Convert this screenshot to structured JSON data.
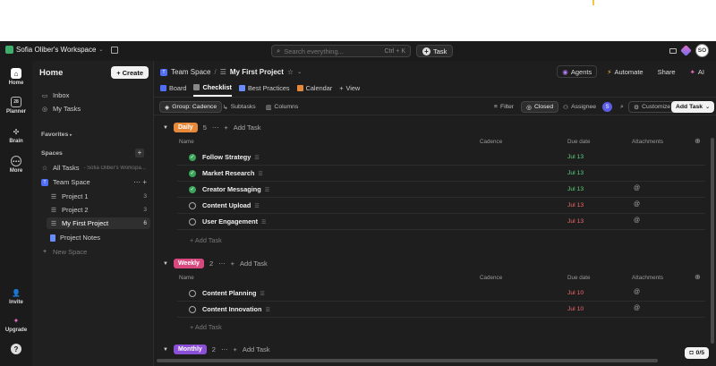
{
  "topbar": {
    "workspace": "Sofia Oliber's Workspace",
    "search_placeholder": "Search everything...",
    "search_shortcut": "Ctrl + K",
    "task_label": "Task",
    "avatar": "SO"
  },
  "rail": {
    "home": "Home",
    "planner": "Planner",
    "brain": "Brain",
    "more": "More",
    "invite": "Invite",
    "upgrade": "Upgrade"
  },
  "sidebar": {
    "title": "Home",
    "create": "Create",
    "inbox": "Inbox",
    "my_tasks": "My Tasks",
    "favorites": "Favorites",
    "spaces": "Spaces",
    "all_tasks": "All Tasks",
    "all_tasks_sub": "- Sofia Oliber's Workspa...",
    "team_space": "Team Space",
    "lists": [
      {
        "label": "Project 1",
        "count": "3"
      },
      {
        "label": "Project 2",
        "count": "3"
      },
      {
        "label": "My First Project",
        "count": "6"
      }
    ],
    "project_notes": "Project Notes",
    "new_space": "New Space"
  },
  "header": {
    "bc_space": "Team Space",
    "bc_sep": "/",
    "bc_list": "My First Project",
    "agents": "Agents",
    "automate": "Automate",
    "share": "Share",
    "ai": "AI",
    "tabs": [
      {
        "label": "Board"
      },
      {
        "label": "Checklist"
      },
      {
        "label": "Best Practices"
      },
      {
        "label": "Calendar"
      },
      {
        "label": "View"
      }
    ]
  },
  "toolbar": {
    "group": "Group: Cadence",
    "subtasks": "Subtasks",
    "columns": "Columns",
    "filter": "Filter",
    "closed": "Closed",
    "assignee": "Assignee",
    "assignee_badge": "S",
    "customize": "Customize",
    "add_task": "Add Task"
  },
  "columns": {
    "name": "Name",
    "cadence": "Cadence",
    "due": "Due date",
    "attachments": "Attachments"
  },
  "groups": [
    {
      "label": "Daily",
      "count": "5",
      "add": "Add Task",
      "color": "#e8893a",
      "tasks": [
        {
          "name": "Follow Strategy",
          "due": "Jul 13",
          "done": true,
          "attach": ""
        },
        {
          "name": "Market Research",
          "due": "Jul 13",
          "done": true,
          "attach": ""
        },
        {
          "name": "Creator Messaging",
          "due": "Jul 13",
          "done": true,
          "attach": "@"
        },
        {
          "name": "Content Upload",
          "due": "Jul 13",
          "done": false,
          "attach": "@"
        },
        {
          "name": "User Engagement",
          "due": "Jul 13",
          "done": false,
          "attach": "@"
        }
      ],
      "footer_add": "Add Task"
    },
    {
      "label": "Weekly",
      "count": "2",
      "add": "Add Task",
      "color": "#d6487e",
      "tasks": [
        {
          "name": "Content Planning",
          "due": "Jul 10",
          "done": false,
          "attach": "@"
        },
        {
          "name": "Content Innovation",
          "due": "Jul 10",
          "done": false,
          "attach": "@"
        }
      ],
      "footer_add": "Add Task"
    },
    {
      "label": "Monthly",
      "count": "2",
      "add": "Add Task",
      "color": "#8c4fd8"
    }
  ],
  "notif": "0/5"
}
